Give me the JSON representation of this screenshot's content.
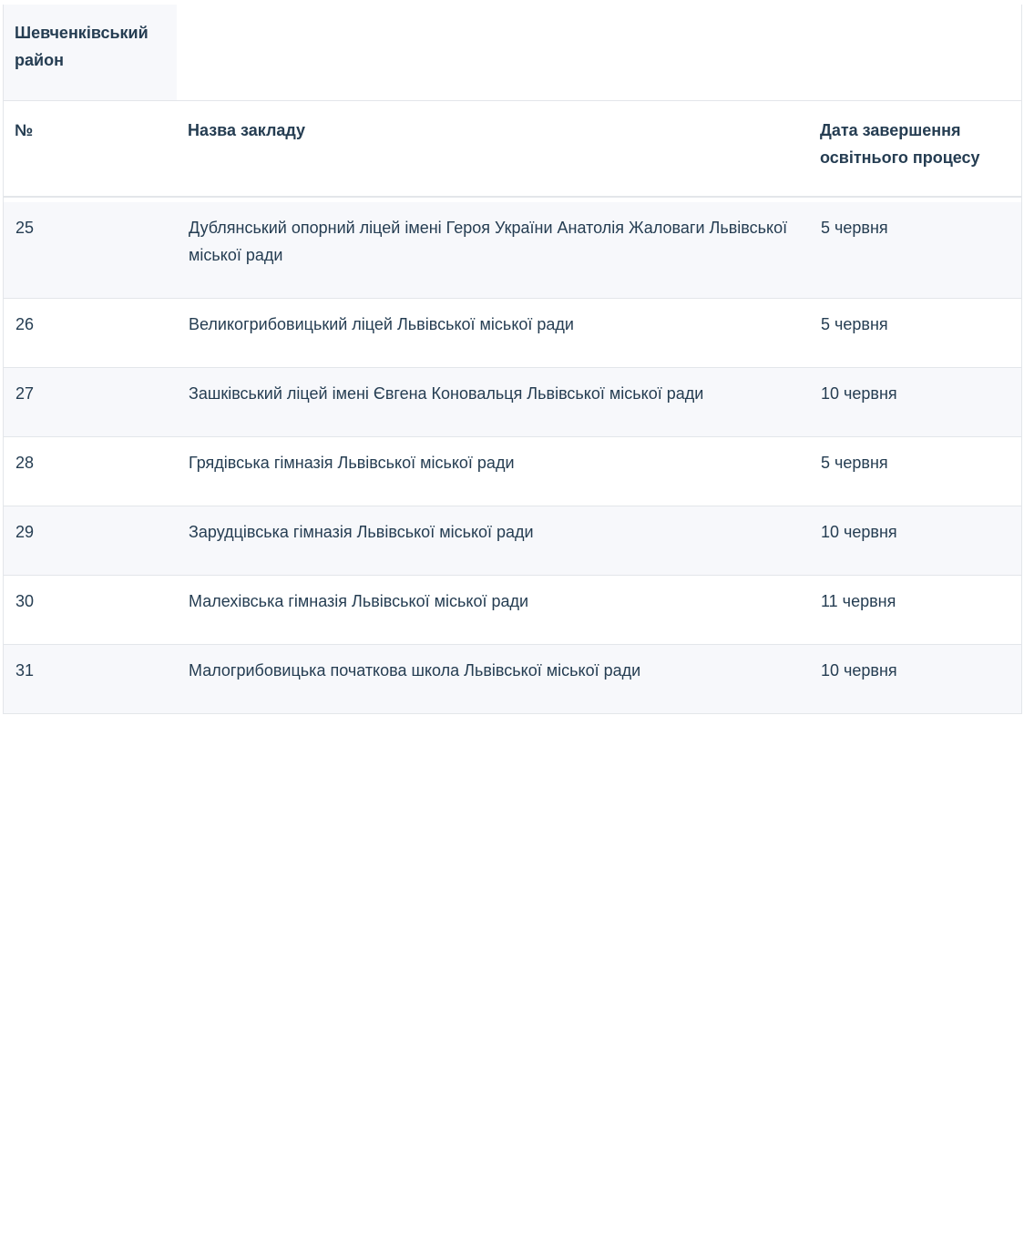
{
  "district": {
    "label": "Шевченківський район"
  },
  "table": {
    "headers": {
      "number": "№",
      "name": "Назва закладу",
      "date": "Дата завершення освітнього процесу"
    },
    "rows": [
      {
        "number": "25",
        "name": "Дублянський опорний ліцей імені Героя України Анатолія Жаловаги Львівської міської ради",
        "date": "5 червня"
      },
      {
        "number": "26",
        "name": "Великогрибовицький ліцей Львівської міської ради",
        "date": "5 червня"
      },
      {
        "number": "27",
        "name": "Зашківський ліцей імені Євгена Коновальця Львівської міської ради",
        "date": "10 червня"
      },
      {
        "number": "28",
        "name": "Грядівська гімназія Львівської міської ради",
        "date": "5 червня"
      },
      {
        "number": "29",
        "name": "Зарудцівська гімназія Львівської міської ради",
        "date": "10 червня"
      },
      {
        "number": "30",
        "name": "Малехівська гімназія Львівської міської ради",
        "date": "11 червня"
      },
      {
        "number": "31",
        "name": "Малогрибовицька початкова школа Львівської міської ради",
        "date": "10 червня"
      }
    ]
  },
  "colors": {
    "text": "#253d52",
    "border": "#e3e6ea",
    "row_shade": "#f7f8fb"
  }
}
